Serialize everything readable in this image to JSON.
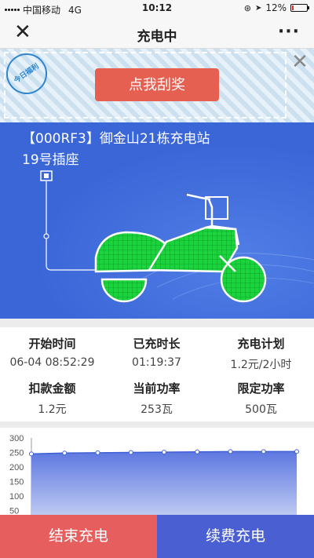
{
  "status_bar": {
    "carrier": "中国移动",
    "network": "4G",
    "time": "10:12",
    "battery": "12%",
    "battery_level": 0.12,
    "battery_color": "#e02b2b"
  },
  "nav": {
    "title": "充电中",
    "close_icon": "close-icon",
    "more_icon": "more-icon"
  },
  "banner": {
    "stamp_text": "今日福利",
    "button_label": "点我刮奖",
    "button_color": "#e66052"
  },
  "device": {
    "station": "【000RF3】御金山21栋充电站",
    "socket": "19号插座",
    "charge_fill_color": "#19d43a",
    "panel_color": "#3b66d8"
  },
  "stats": [
    {
      "label": "开始时间",
      "value": "06-04 08:52:29"
    },
    {
      "label": "已充时长",
      "value": "01:19:37"
    },
    {
      "label": "充电计划",
      "value": "1.2元/2小时"
    },
    {
      "label": "扣款金额",
      "value": "1.2元"
    },
    {
      "label": "当前功率",
      "value": "253瓦"
    },
    {
      "label": "限定功率",
      "value": "500瓦"
    }
  ],
  "chart_data": {
    "type": "area",
    "title": "",
    "xlabel": "",
    "ylabel": "",
    "yticks": [
      300,
      250,
      200,
      150,
      100,
      50
    ],
    "ylim": [
      0,
      300
    ],
    "series": [
      {
        "values": [
          245,
          248,
          249,
          250,
          251,
          252,
          253,
          253,
          253
        ]
      }
    ],
    "grid": false
  },
  "actions": {
    "end_label": "结束充电",
    "renew_label": "续费充电",
    "end_color": "#e65e5e",
    "renew_color": "#4a5fd1"
  }
}
